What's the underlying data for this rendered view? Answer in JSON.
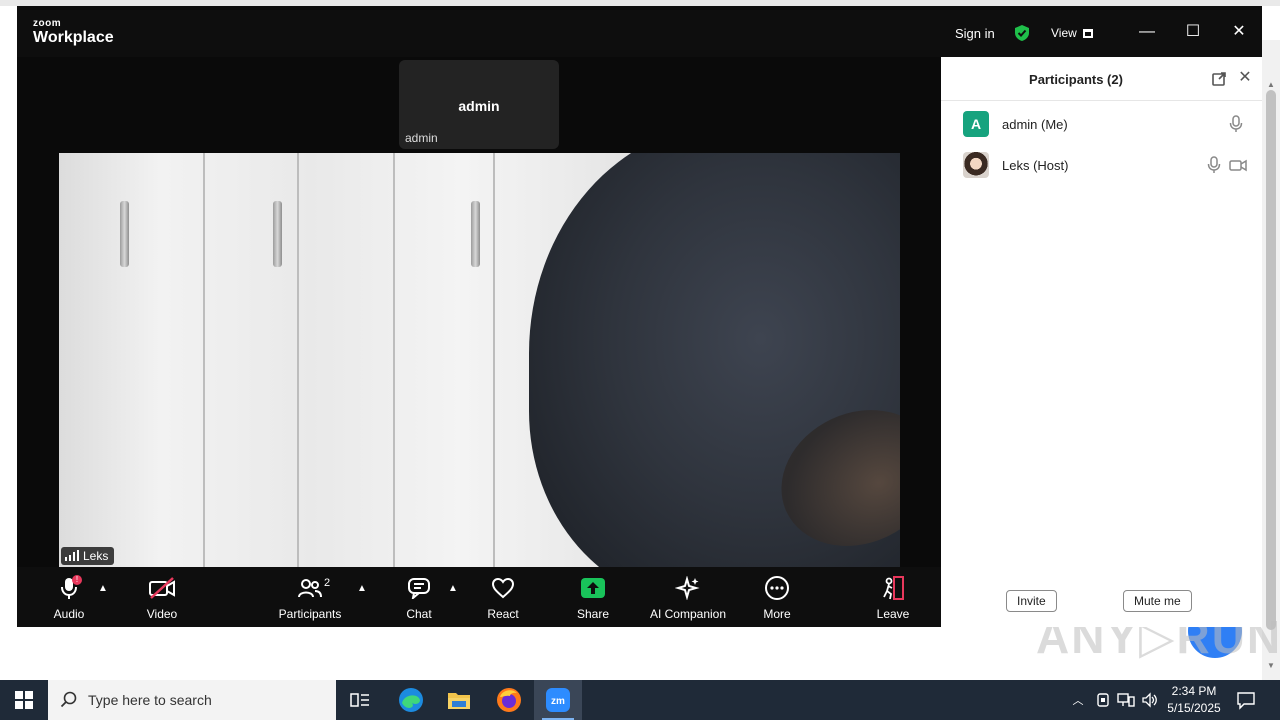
{
  "window": {
    "logo_line1": "zoom",
    "logo_line2": "Workplace",
    "sign_in": "Sign in",
    "view_label": "View"
  },
  "meeting": {
    "self_tile_name": "admin",
    "self_tile_tag": "admin",
    "speaker_label": "Leks"
  },
  "toolbar": {
    "audio": "Audio",
    "audio_badge": "!",
    "video": "Video",
    "participants": "Participants",
    "participants_count": "2",
    "chat": "Chat",
    "react": "React",
    "share": "Share",
    "ai_companion": "AI Companion",
    "more": "More",
    "leave": "Leave"
  },
  "panel": {
    "title": "Participants (2)",
    "participants": [
      {
        "name": "admin (Me)",
        "initial": "A"
      },
      {
        "name": "Leks (Host)"
      }
    ],
    "invite": "Invite",
    "mute_me": "Mute me"
  },
  "taskbar": {
    "search_placeholder": "Type here to search",
    "time": "2:34 PM",
    "date": "5/15/2025"
  },
  "colors": {
    "zoom_bg": "#0e0e0e",
    "share_green": "#19c35a",
    "host_avatar_green": "#16a37e",
    "leave_red": "#e8385c",
    "taskbar": "#1f2a38"
  }
}
